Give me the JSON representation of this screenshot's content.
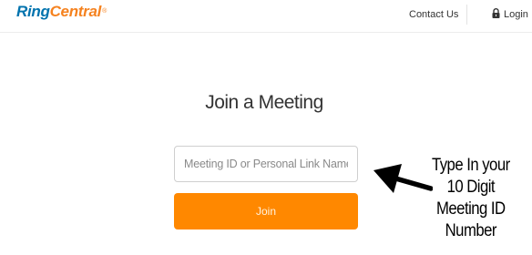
{
  "header": {
    "logo": {
      "ring": "Ring",
      "central": "Central",
      "registered": "®"
    },
    "contact_label": "Contact Us",
    "login_label": "Login",
    "login_icon": "lock-icon"
  },
  "main": {
    "title": "Join a Meeting",
    "meeting_input": {
      "placeholder": "Meeting ID or Personal Link Name",
      "value": ""
    },
    "join_label": "Join"
  },
  "annotation": {
    "lines": [
      "Type In your",
      "10 Digit",
      "Meeting ID",
      "Number"
    ],
    "arrow_icon": "arrow-left-icon"
  },
  "colors": {
    "brand_blue": "#0073ae",
    "brand_orange": "#f5821f",
    "join_button": "#ff8800"
  }
}
